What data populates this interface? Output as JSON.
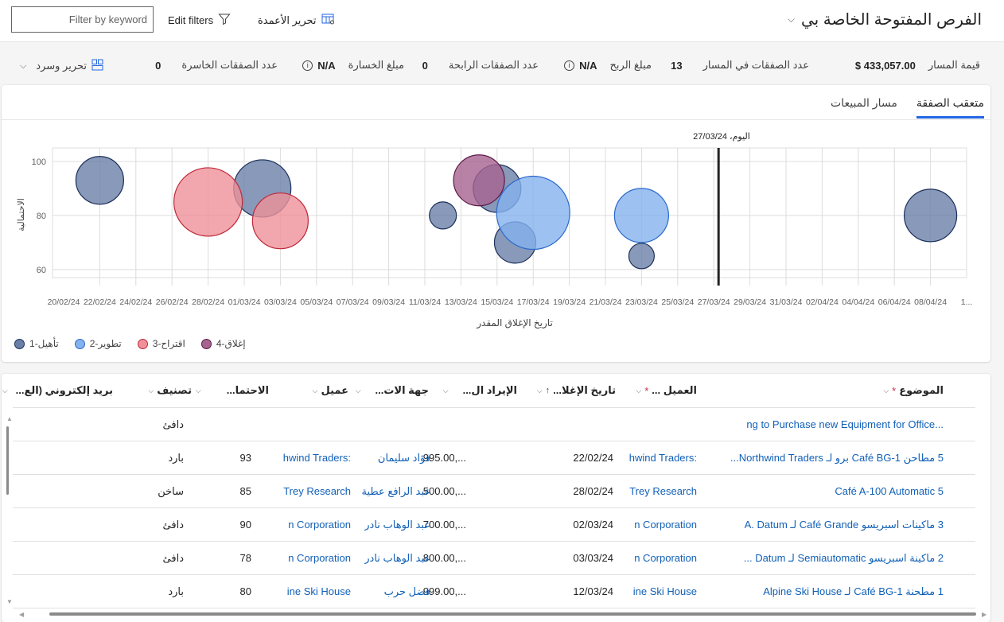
{
  "header": {
    "title": "الفرص المفتوحة الخاصة بي",
    "filter_placeholder": "Filter by keyword",
    "edit_filters_label": "Edit filters",
    "edit_columns_label": "تحرير الأعمدة"
  },
  "kpis": {
    "pipeline_value_label": "قيمة المسار",
    "pipeline_value": "$ 433,057.00",
    "deals_in_pipeline_label": "عدد الصفقات في المسار",
    "deals_in_pipeline": "13",
    "won_amount_label": "مبلغ الربح",
    "won_amount": "N/A",
    "won_deals_label": "عدد الصفقات الرابحة",
    "won_deals": "0",
    "lost_amount_label": "مبلغ الخسارة",
    "lost_amount": "N/A",
    "lost_deals_label": "عدد الصفقات الخاسرة",
    "lost_deals": "0",
    "edit_narrate_label": "تحرير وسرد"
  },
  "tabs": [
    {
      "label": "متعقب الصفقة",
      "active": true
    },
    {
      "label": "مسار المبيعات",
      "active": false
    }
  ],
  "chart_data": {
    "type": "scatter",
    "subtype": "bubble",
    "title": "",
    "today_label": "اليوم، 27/03/24",
    "today": "27/03/24",
    "xlabel": "تاريخ الإغلاق المقدر",
    "ylabel": "الاحتمالية",
    "x_range": [
      "20/02/24",
      "10/04/24"
    ],
    "x_ticks": [
      "20/02/24",
      "22/02/24",
      "24/02/24",
      "26/02/24",
      "28/02/24",
      "01/03/24",
      "03/03/24",
      "05/03/24",
      "07/03/24",
      "09/03/24",
      "11/03/24",
      "13/03/24",
      "15/03/24",
      "17/03/24",
      "19/03/24",
      "21/03/24",
      "23/03/24",
      "25/03/24",
      "27/03/24",
      "29/03/24",
      "31/03/24",
      "02/04/24",
      "04/04/24",
      "06/04/24",
      "08/04/24",
      "1..."
    ],
    "ylim": [
      57,
      105
    ],
    "y_ticks": [
      60,
      80,
      100
    ],
    "grid": true,
    "legend_position": "bottom-left",
    "series": [
      {
        "name": "تأهيل-1",
        "color": "#6a7fa8",
        "stroke": "#1b2f5a",
        "points": [
          {
            "date": "22/02/24",
            "probability": 93,
            "size": 30
          },
          {
            "date": "02/03/24",
            "probability": 90,
            "size": 36
          },
          {
            "date": "12/03/24",
            "probability": 80,
            "size": 17
          },
          {
            "date": "15/03/24",
            "probability": 90,
            "size": 30
          },
          {
            "date": "16/03/24",
            "probability": 70,
            "size": 26
          },
          {
            "date": "23/03/24",
            "probability": 65,
            "size": 16
          },
          {
            "date": "08/04/24",
            "probability": 80,
            "size": 33
          }
        ]
      },
      {
        "name": "تطوير-2",
        "color": "#84b2ee",
        "stroke": "#2a6acb",
        "points": [
          {
            "date": "17/03/24",
            "probability": 81,
            "size": 46
          },
          {
            "date": "23/03/24",
            "probability": 80,
            "size": 34
          }
        ]
      },
      {
        "name": "اقتراح-3",
        "color": "#ee9199",
        "stroke": "#c0283a",
        "points": [
          {
            "date": "28/02/24",
            "probability": 85,
            "size": 43
          },
          {
            "date": "03/03/24",
            "probability": 78,
            "size": 35
          }
        ]
      },
      {
        "name": "إغلاق-4",
        "color": "#a66390",
        "stroke": "#5a1a47",
        "points": [
          {
            "date": "14/03/24",
            "probability": 93,
            "size": 32
          }
        ]
      }
    ]
  },
  "grid": {
    "columns": [
      {
        "label": "الموضوع",
        "required": true
      },
      {
        "label": "العميل ...",
        "required": true
      },
      {
        "label": "تاريخ الإغلا...",
        "sorted": "asc"
      },
      {
        "label": "الإيراد ال..."
      },
      {
        "label": "جهة الات..."
      },
      {
        "label": "عميل"
      },
      {
        "label": "الاحتما..."
      },
      {
        "label": "تصنيف"
      },
      {
        "label": "بريد إلكتروني (الع..."
      }
    ],
    "rows": [
      {
        "topic": "...ng to Purchase new Equipment for Office",
        "account": "",
        "close_date": "",
        "revenue": "",
        "contact": "",
        "customer": "",
        "probability": "",
        "rating": "دافئ",
        "email": ""
      },
      {
        "topic": "5 مطاحن Café BG-1 برو لـ Northwind Traders...",
        "account": ":hwind Traders",
        "close_date": "22/02/24",
        "revenue": "...,995.00",
        "contact": "فؤاد سليمان",
        "customer": ":hwind Traders",
        "probability": "93",
        "rating": "بارد",
        "email": ""
      },
      {
        "topic": "Café A-100 Automatic 5",
        "account": "Trey Research",
        "close_date": "28/02/24",
        "revenue": "...,500.00",
        "contact": "عبد الرافع عطية",
        "customer": "Trey Research",
        "probability": "85",
        "rating": "ساخن",
        "email": ""
      },
      {
        "topic": "3 ماكينات اسبريسو Café Grande لـ A. Datum",
        "account": "n Corporation",
        "close_date": "02/03/24",
        "revenue": "...,700.00",
        "contact": "عبد الوهاب نادر",
        "customer": "n Corporation",
        "probability": "90",
        "rating": "دافئ",
        "email": ""
      },
      {
        "topic": "2 ماكينة اسبريسو Semiautomatic لـ Datum ...",
        "account": "n Corporation",
        "close_date": "03/03/24",
        "revenue": "...,800.00",
        "contact": "عبد الوهاب نادر",
        "customer": "n Corporation",
        "probability": "78",
        "rating": "دافئ",
        "email": ""
      },
      {
        "topic": "1 مطحنة Café BG-1 لـ Alpine Ski House",
        "account": "ine Ski House",
        "close_date": "12/03/24",
        "revenue": "...,999.00",
        "contact": "فضل حرب",
        "customer": "ine Ski House",
        "probability": "80",
        "rating": "بارد",
        "email": ""
      }
    ]
  }
}
